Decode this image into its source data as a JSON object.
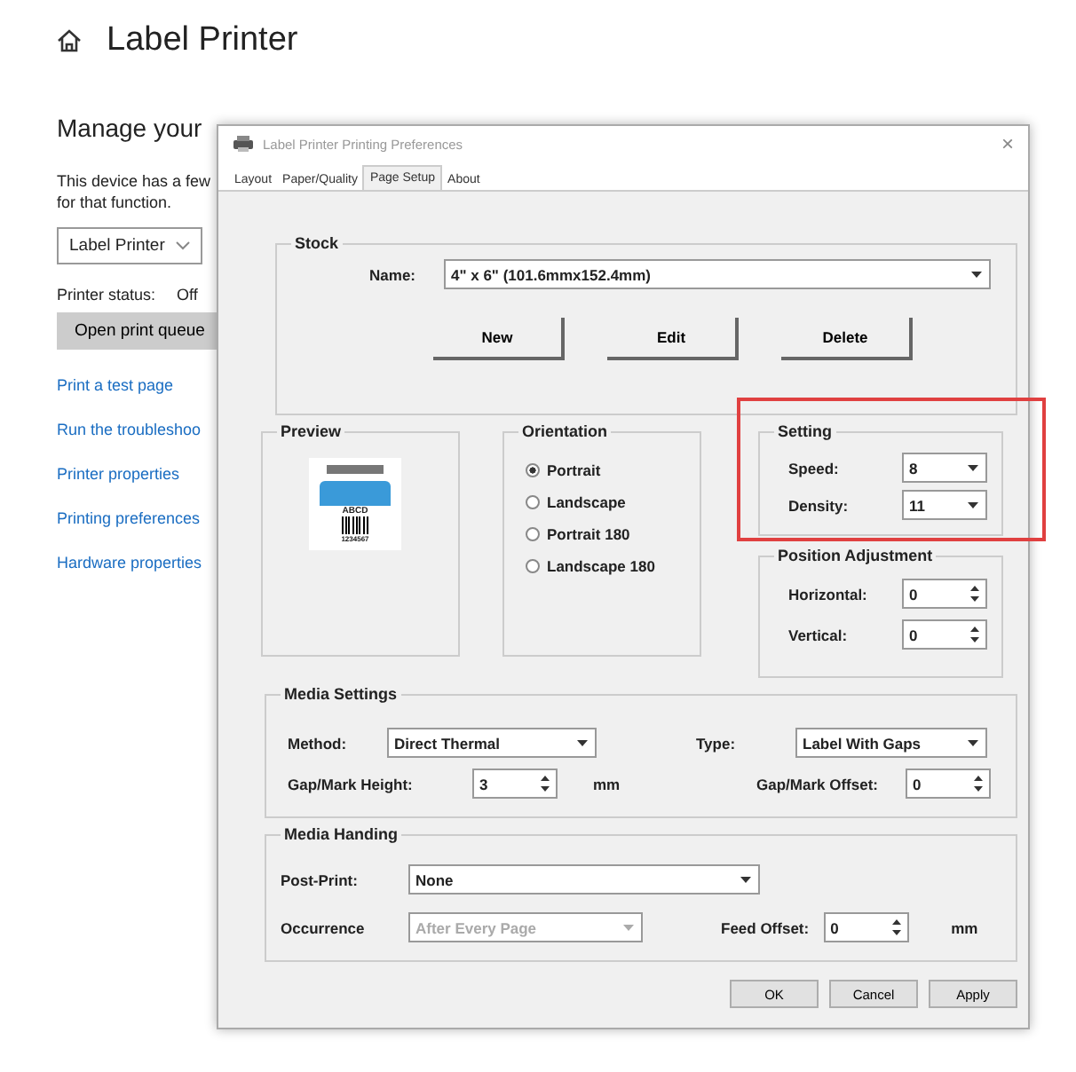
{
  "page": {
    "title": "Label Printer",
    "heading": "Manage your",
    "description": [
      "This device has a few",
      "for that function."
    ],
    "device_select": "Label Printer",
    "status_label": "Printer status:",
    "status_value": "Off",
    "queue_button": "Open print queue",
    "links": [
      "Print a test page",
      "Run the troubleshoo",
      "Printer properties",
      "Printing preferences",
      "Hardware properties"
    ]
  },
  "dialog": {
    "title": "Label Printer Printing Preferences",
    "close": "×",
    "tabs": [
      {
        "label": "Layout",
        "selected": false
      },
      {
        "label": "Paper/Quality",
        "selected": false
      },
      {
        "label": "Page Setup",
        "selected": true
      },
      {
        "label": "About",
        "selected": false
      }
    ],
    "stock": {
      "title": "Stock",
      "name_label": "Name:",
      "name_value": "4\" x 6\" (101.6mmx152.4mm)",
      "buttons": [
        "New",
        "Edit",
        "Delete"
      ]
    },
    "preview": {
      "title": "Preview",
      "label_text": "ABCD",
      "label_number": "1234567"
    },
    "orientation": {
      "title": "Orientation",
      "options": [
        {
          "label": "Portrait",
          "selected": true
        },
        {
          "label": "Landscape",
          "selected": false
        },
        {
          "label": "Portrait 180",
          "selected": false
        },
        {
          "label": "Landscape 180",
          "selected": false
        }
      ]
    },
    "setting": {
      "title": "Setting",
      "highlighted": true,
      "fields": [
        {
          "label": "Speed:",
          "value": "8"
        },
        {
          "label": "Density:",
          "value": "11"
        }
      ]
    },
    "position": {
      "title": "Position Adjustment",
      "fields": [
        {
          "label": "Horizontal:",
          "value": "0"
        },
        {
          "label": "Vertical:",
          "value": "0"
        }
      ]
    },
    "media_settings": {
      "title": "Media Settings",
      "method_label": "Method:",
      "method_value": "Direct Thermal",
      "type_label": "Type:",
      "type_value": "Label With Gaps",
      "height_label": "Gap/Mark Height:",
      "height_value": "3",
      "height_unit": "mm",
      "offset_label": "Gap/Mark Offset:",
      "offset_value": "0"
    },
    "media_handling": {
      "title": "Media Handing",
      "post_label": "Post-Print:",
      "post_value": "None",
      "occurrence_label": "Occurrence",
      "occurrence_value": "After Every Page",
      "occurrence_disabled": true,
      "feed_label": "Feed Offset:",
      "feed_value": "0",
      "feed_unit": "mm"
    },
    "buttons": [
      "OK",
      "Cancel",
      "Apply"
    ]
  }
}
